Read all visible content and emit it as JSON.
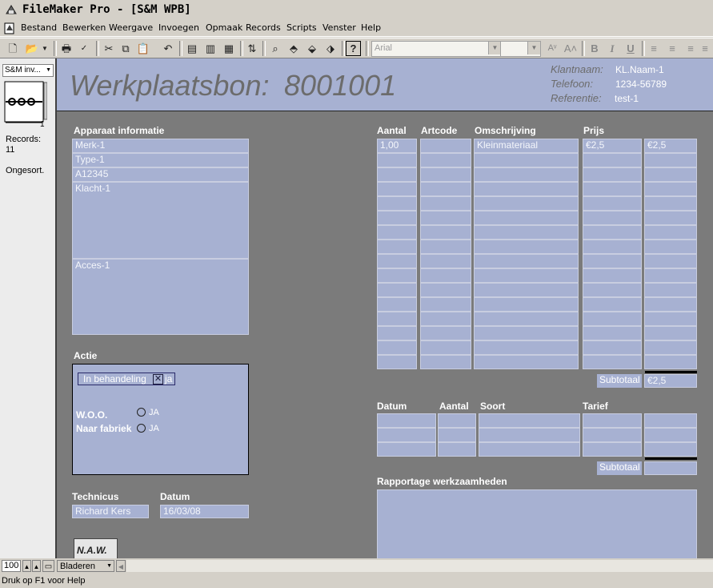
{
  "window": {
    "title": "FileMaker Pro - [S&M WPB]"
  },
  "menu": [
    "Bestand",
    "Bewerken",
    "Weergave",
    "Invoegen",
    "Opmaak",
    "Records",
    "Scripts",
    "Venster",
    "Help"
  ],
  "toolbar": {
    "font": "Arial"
  },
  "sidebar": {
    "layout": "S&M inv...",
    "page": "1",
    "records_label": "Records:",
    "records_count": "11",
    "sort_state": "Ongesort."
  },
  "header": {
    "title": "Werkplaatsbon:",
    "number": "8001001",
    "klantnaam_label": "Klantnaam:",
    "klantnaam": "KL.Naam-1",
    "telefoon_label": "Telefoon:",
    "telefoon": "1234-56789",
    "referentie_label": "Referentie:",
    "referentie": "test-1"
  },
  "apparaat": {
    "heading": "Apparaat informatie",
    "merk": "Merk-1",
    "type": "Type-1",
    "serial": "A12345",
    "klacht": "Klacht-1",
    "acces": "Acces-1"
  },
  "actie": {
    "heading": "Actie",
    "status": "In behandeling",
    "status_check": "ja",
    "woo_label": "W.O.O.",
    "woo_option": "JA",
    "fabriek_label": "Naar fabriek",
    "fabriek_option": "JA"
  },
  "technicus": {
    "label": "Technicus",
    "value": "Richard  Kers",
    "datum_label": "Datum",
    "datum": "16/03/08"
  },
  "lines": {
    "headers": {
      "aantal": "Aantal",
      "artcode": "Artcode",
      "omschrijving": "Omschrijving",
      "prijs": "Prijs"
    },
    "rows": [
      {
        "aantal": "1,00",
        "artcode": "",
        "omschrijving": "Kleinmateriaal",
        "prijs": "€2,5",
        "totaal": "€2,5"
      }
    ],
    "subtotaal_label": "Subtotaal",
    "subtotaal": "€2,5"
  },
  "labor": {
    "headers": {
      "datum": "Datum",
      "aantal": "Aantal",
      "soort": "Soort",
      "tarief": "Tarief"
    },
    "subtotaal_label": "Subtotaal",
    "subtotaal": ""
  },
  "rapportage": {
    "heading": "Rapportage werkzaamheden"
  },
  "naw_button": "N.A.W.",
  "bottom": {
    "zoom": "100",
    "mode": "Bladeren",
    "help": "Druk op F1 voor Help"
  },
  "colors": {
    "field": "#a7b1d2",
    "background": "#7b7b7b"
  }
}
